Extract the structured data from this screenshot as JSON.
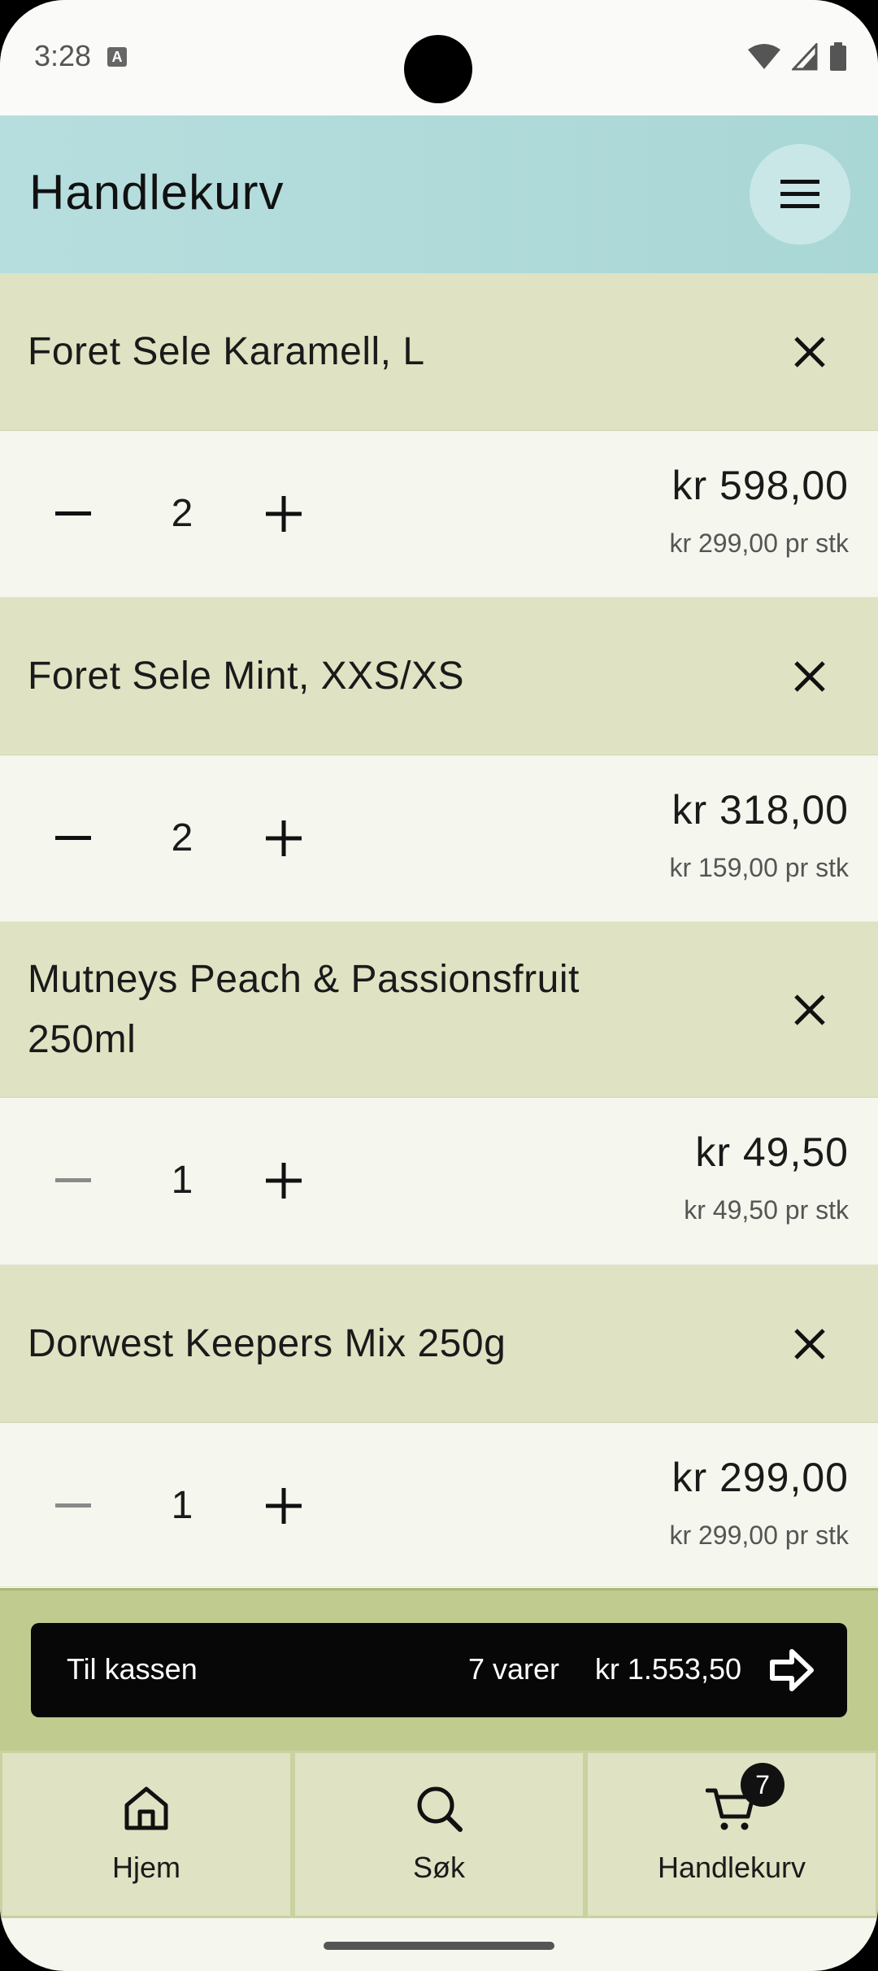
{
  "status_bar": {
    "time": "3:28",
    "notification_glyph": "A"
  },
  "app_bar": {
    "title": "Handlekurv"
  },
  "cart": {
    "items": [
      {
        "name": "Foret Sele Karamell, L",
        "quantity": "2",
        "total": "kr 598,00",
        "unit_price": "kr 299,00 pr stk"
      },
      {
        "name": "Foret Sele Mint, XXS/XS",
        "quantity": "2",
        "total": "kr 318,00",
        "unit_price": "kr 159,00 pr stk"
      },
      {
        "name": "Mutneys Peach & Passionsfruit 250ml",
        "quantity": "1",
        "total": "kr 49,50",
        "unit_price": "kr 49,50 pr stk"
      },
      {
        "name": "Dorwest Keepers Mix 250g",
        "quantity": "1",
        "total": "kr 299,00",
        "unit_price": "kr 299,00 pr stk"
      }
    ]
  },
  "checkout": {
    "label": "Til kassen",
    "count": "7 varer",
    "total": "kr 1.553,50"
  },
  "bottom_nav": {
    "items": [
      {
        "label": "Hjem",
        "icon": "home-icon"
      },
      {
        "label": "Søk",
        "icon": "search-icon"
      },
      {
        "label": "Handlekurv",
        "icon": "cart-icon",
        "badge": "7"
      }
    ]
  },
  "colors": {
    "app_bar": "#b7dede",
    "item_header": "#dfe3c3",
    "item_body": "#f5f6ee",
    "checkout_area": "#c0cb90",
    "checkout_button": "#070707"
  }
}
